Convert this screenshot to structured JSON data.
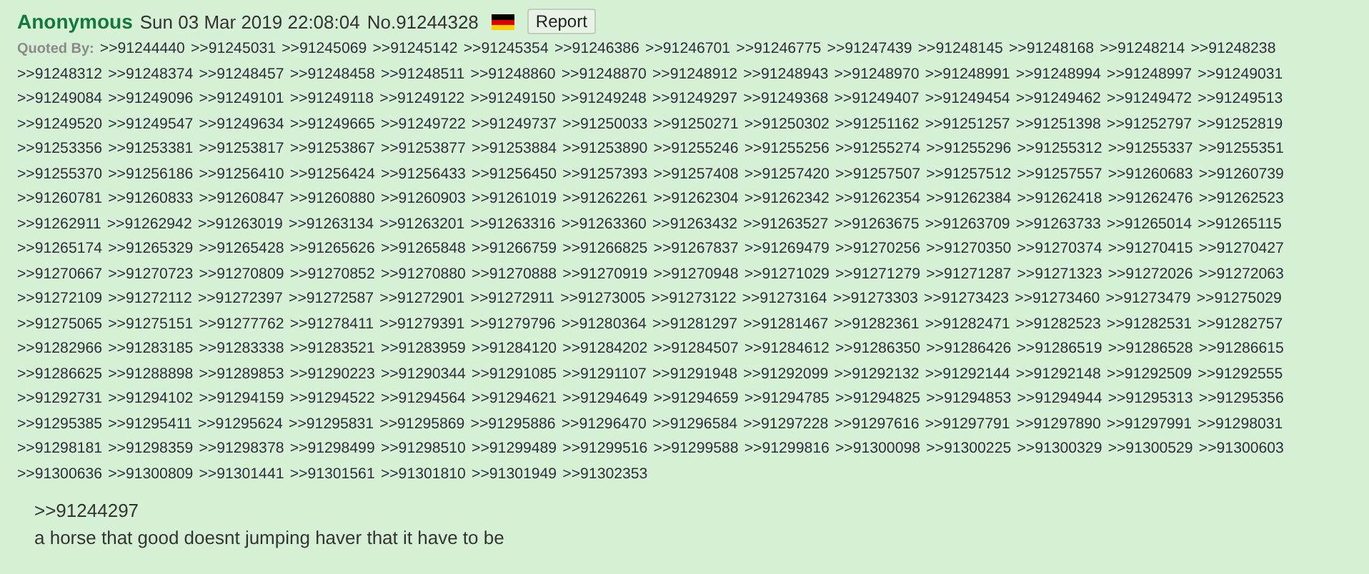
{
  "post": {
    "name": "Anonymous",
    "datetime": "Sun 03 Mar 2019 22:08:04",
    "number": "No.91244328",
    "report_button": "Report"
  },
  "quoted_by": {
    "label": "Quoted By:",
    "lines": [
      [
        ">>91244440",
        ">>91245031",
        ">>91245069",
        ">>91245142",
        ">>91245354",
        ">>91246386",
        ">>91246701",
        ">>91246775",
        ">>91247439",
        ">>91248145",
        ">>91248168",
        ">>91248214",
        ">>91248238"
      ],
      [
        ">>91248312",
        ">>91248374",
        ">>91248457",
        ">>91248458",
        ">>91248511",
        ">>91248860",
        ">>91248870",
        ">>91248912",
        ">>91248943",
        ">>91248970",
        ">>91248991",
        ">>91248994",
        ">>91248997",
        ">>91249031"
      ],
      [
        ">>91249084",
        ">>91249096",
        ">>91249101",
        ">>91249118",
        ">>91249122",
        ">>91249150",
        ">>91249248",
        ">>91249297",
        ">>91249368",
        ">>91249407",
        ">>91249454",
        ">>91249462",
        ">>91249472",
        ">>91249513"
      ],
      [
        ">>91249520",
        ">>91249547",
        ">>91249634",
        ">>91249665",
        ">>91249722",
        ">>91249737",
        ">>91250033",
        ">>91250271",
        ">>91250302",
        ">>91251162",
        ">>91251257",
        ">>91251398",
        ">>91252797",
        ">>91252819"
      ],
      [
        ">>91253356",
        ">>91253381",
        ">>91253817",
        ">>91253867",
        ">>91253877",
        ">>91253884",
        ">>91253890",
        ">>91255246",
        ">>91255256",
        ">>91255274",
        ">>91255296",
        ">>91255312",
        ">>91255337",
        ">>91255351"
      ],
      [
        ">>91255370",
        ">>91256186",
        ">>91256410",
        ">>91256424",
        ">>91256433",
        ">>91256450",
        ">>91257393",
        ">>91257408",
        ">>91257420",
        ">>91257507",
        ">>91257512",
        ">>91257557",
        ">>91260683",
        ">>91260739"
      ],
      [
        ">>91260781",
        ">>91260833",
        ">>91260847",
        ">>91260880",
        ">>91260903",
        ">>91261019",
        ">>91262261",
        ">>91262304",
        ">>91262342",
        ">>91262354",
        ">>91262384",
        ">>91262418",
        ">>91262476",
        ">>91262523"
      ],
      [
        ">>91262911",
        ">>91262942",
        ">>91263019",
        ">>91263134",
        ">>91263201",
        ">>91263316",
        ">>91263360",
        ">>91263432",
        ">>91263527",
        ">>91263675",
        ">>91263709",
        ">>91263733",
        ">>91265014",
        ">>91265115"
      ],
      [
        ">>91265174",
        ">>91265329",
        ">>91265428",
        ">>91265626",
        ">>91265848",
        ">>91266759",
        ">>91266825",
        ">>91267837",
        ">>91269479",
        ">>91270256",
        ">>91270350",
        ">>91270374",
        ">>91270415",
        ">>91270427"
      ],
      [
        ">>91270667",
        ">>91270723",
        ">>91270809",
        ">>91270852",
        ">>91270880",
        ">>91270888",
        ">>91270919",
        ">>91270948",
        ">>91271029",
        ">>91271279",
        ">>91271287",
        ">>91271323",
        ">>91272026",
        ">>91272063"
      ],
      [
        ">>91272109",
        ">>91272112",
        ">>91272397",
        ">>91272587",
        ">>91272901",
        ">>91272911",
        ">>91273005",
        ">>91273122",
        ">>91273164",
        ">>91273303",
        ">>91273423",
        ">>91273460",
        ">>91273479",
        ">>91275029"
      ],
      [
        ">>91275065",
        ">>91275151",
        ">>91277762",
        ">>91278411",
        ">>91279391",
        ">>91279796",
        ">>91280364",
        ">>91281297",
        ">>91281467",
        ">>91282361",
        ">>91282471",
        ">>91282523",
        ">>91282531",
        ">>91282757"
      ],
      [
        ">>91282966",
        ">>91283185",
        ">>91283338",
        ">>91283521",
        ">>91283959",
        ">>91284120",
        ">>91284202",
        ">>91284507",
        ">>91284612",
        ">>91286350",
        ">>91286426",
        ">>91286519",
        ">>91286528",
        ">>91286615"
      ],
      [
        ">>91286625",
        ">>91288898",
        ">>91289853",
        ">>91290223",
        ">>91290344",
        ">>91291085",
        ">>91291107",
        ">>91291948",
        ">>91292099",
        ">>91292132",
        ">>91292144",
        ">>91292148",
        ">>91292509",
        ">>91292555"
      ],
      [
        ">>91292731",
        ">>91294102",
        ">>91294159",
        ">>91294522",
        ">>91294564",
        ">>91294621",
        ">>91294649",
        ">>91294659",
        ">>91294785",
        ">>91294825",
        ">>91294853",
        ">>91294944",
        ">>91295313",
        ">>91295356"
      ],
      [
        ">>91295385",
        ">>91295411",
        ">>91295624",
        ">>91295831",
        ">>91295869",
        ">>91295886",
        ">>91296470",
        ">>91296584",
        ">>91297228",
        ">>91297616",
        ">>91297791",
        ">>91297890",
        ">>91297991",
        ">>91298031"
      ],
      [
        ">>91298181",
        ">>91298359",
        ">>91298378",
        ">>91298499",
        ">>91298510",
        ">>91299489",
        ">>91299516",
        ">>91299588",
        ">>91299816",
        ">>91300098",
        ">>91300225",
        ">>91300329",
        ">>91300529",
        ">>91300603"
      ],
      [
        ">>91300636",
        ">>91300809",
        ">>91301441",
        ">>91301561",
        ">>91301810",
        ">>91301949",
        ">>91302353"
      ]
    ]
  },
  "message": {
    "quote_link": ">>91244297",
    "text": "a horse that good doesnt jumping haver that it have to be"
  }
}
